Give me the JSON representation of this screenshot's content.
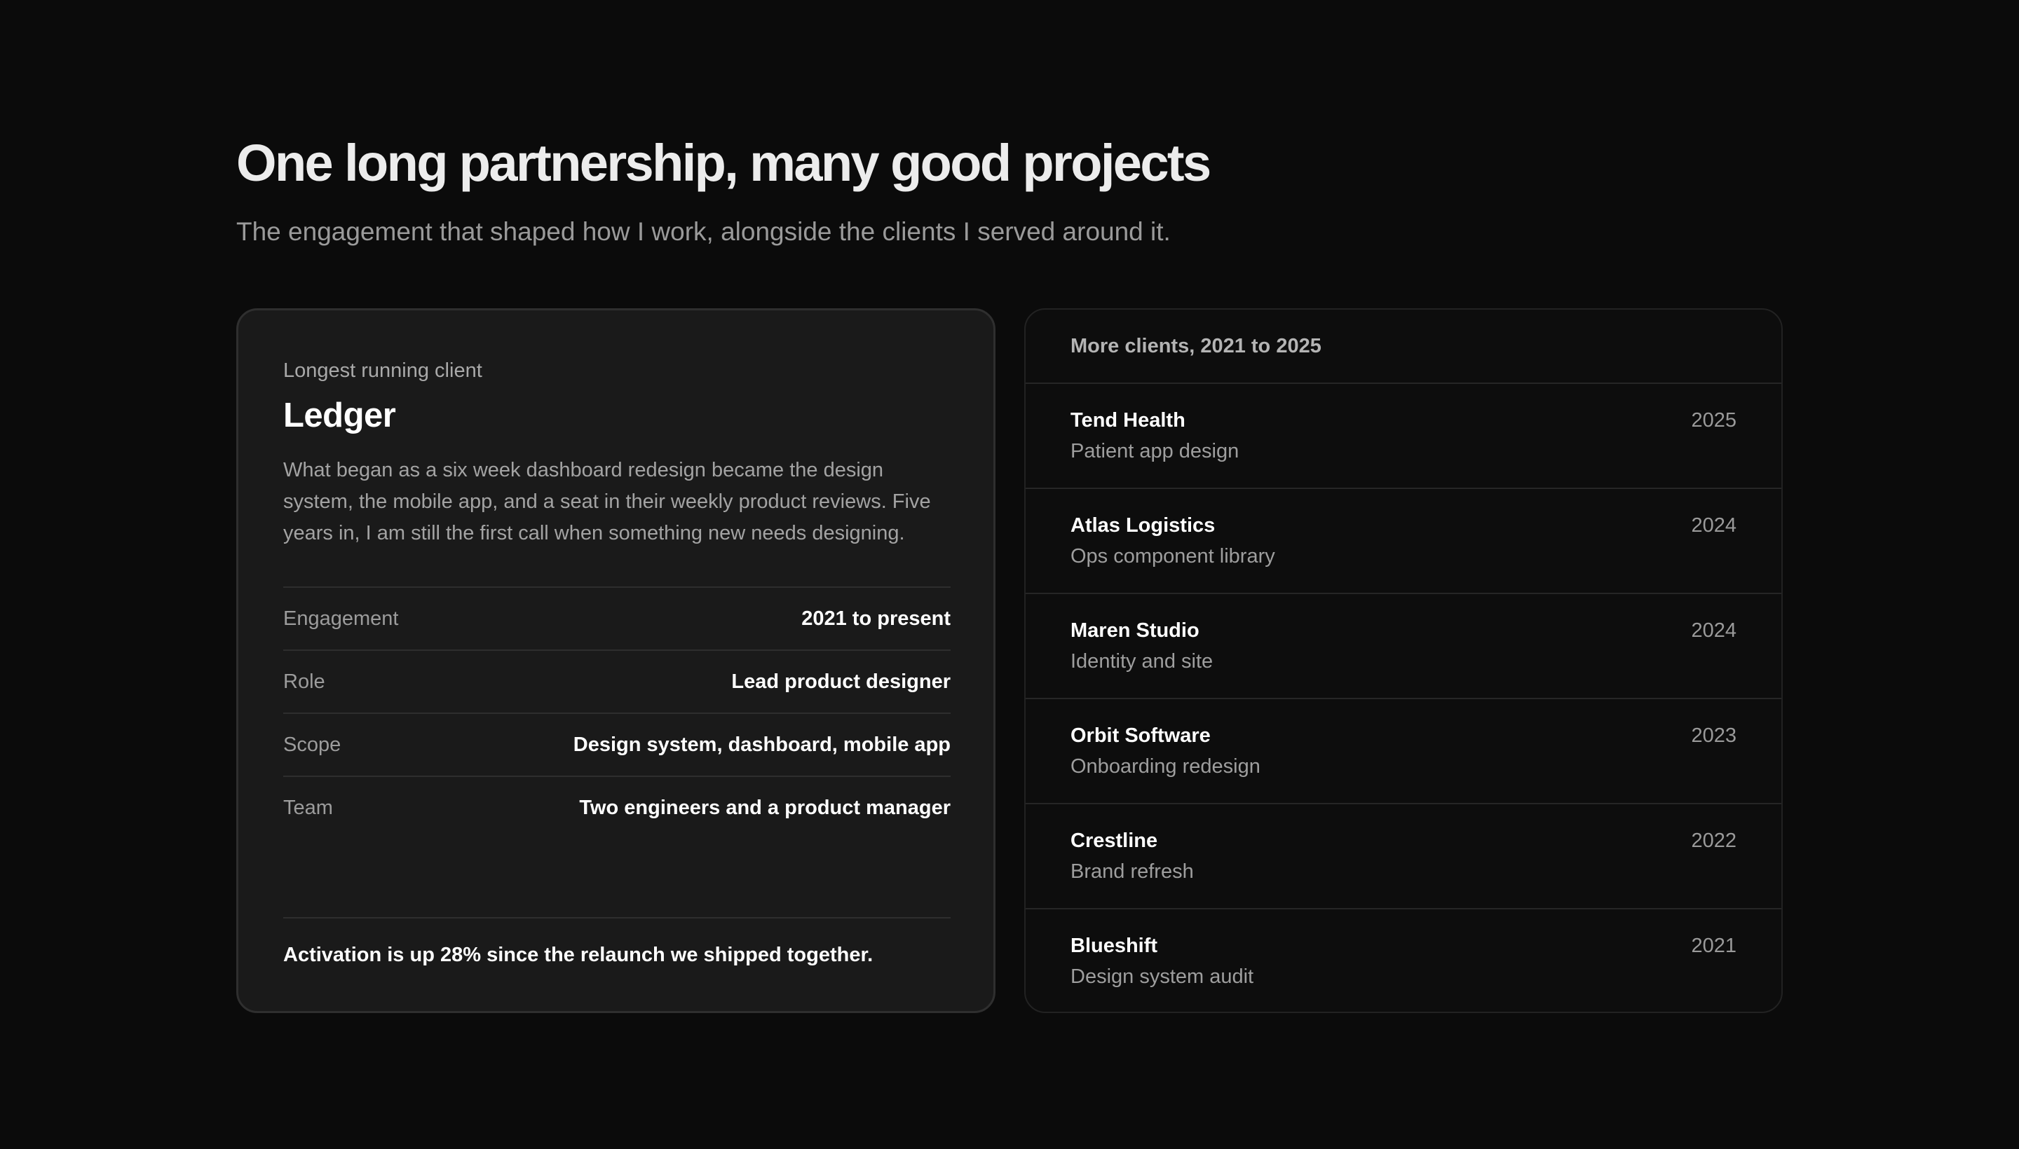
{
  "header": {
    "title": "One long partnership, many good projects",
    "subtitle": "The engagement that shaped how I work, alongside the clients I served around it."
  },
  "feature": {
    "eyebrow": "Longest running client",
    "name": "Ledger",
    "description": "What began as a six week dashboard redesign became the design system, the mobile app, and a seat in their weekly product reviews. Five years in, I am still the first call when something new needs designing.",
    "facts": [
      {
        "label": "Engagement",
        "value": "2021 to present"
      },
      {
        "label": "Role",
        "value": "Lead product designer"
      },
      {
        "label": "Scope",
        "value": "Design system, dashboard, mobile app"
      },
      {
        "label": "Team",
        "value": "Two engineers and a product manager"
      }
    ],
    "footer_note": "Activation is up 28% since the relaunch we shipped together."
  },
  "clients": {
    "title": "More clients, 2021 to 2025",
    "items": [
      {
        "name": "Tend Health",
        "project": "Patient app design",
        "year": "2025"
      },
      {
        "name": "Atlas Logistics",
        "project": "Ops component library",
        "year": "2024"
      },
      {
        "name": "Maren Studio",
        "project": "Identity and site",
        "year": "2024"
      },
      {
        "name": "Orbit Software",
        "project": "Onboarding redesign",
        "year": "2023"
      },
      {
        "name": "Crestline",
        "project": "Brand refresh",
        "year": "2022"
      },
      {
        "name": "Blueshift",
        "project": "Design system audit",
        "year": "2021"
      }
    ]
  }
}
